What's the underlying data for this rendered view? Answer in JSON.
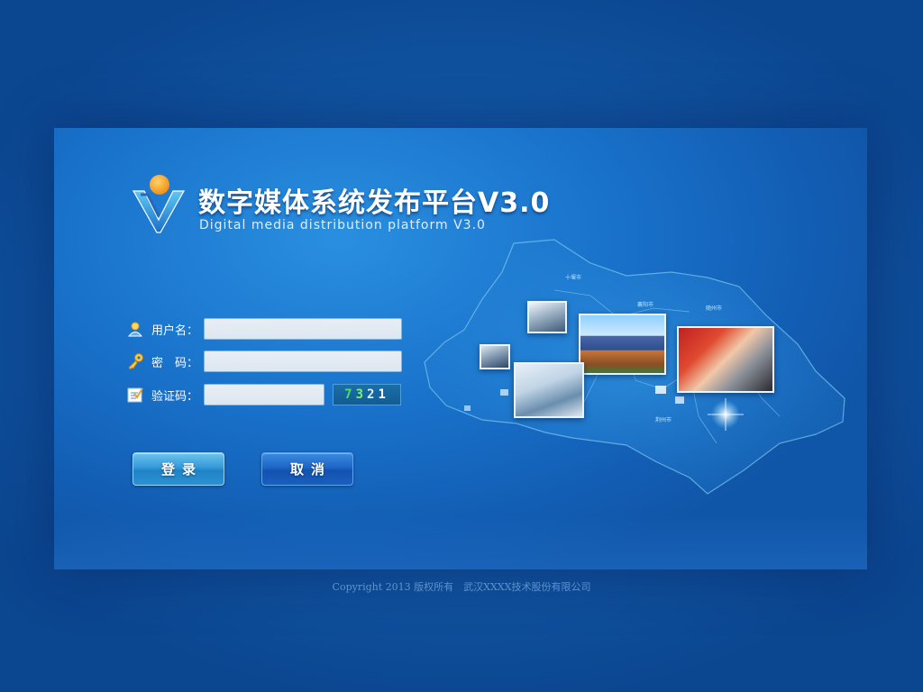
{
  "header": {
    "title_cn": "数字媒体系统发布平台V3.0",
    "title_en": "Digital media distribution platform V3.0"
  },
  "form": {
    "username_label": "用户名：",
    "password_label": "密　码：",
    "captcha_label": "验证码：",
    "username_value": "",
    "password_value": "",
    "captcha_value": "",
    "captcha_code": [
      "7",
      "3",
      "2",
      "1"
    ]
  },
  "buttons": {
    "login_label": "登录",
    "cancel_label": "取消"
  },
  "map_labels": {
    "place_1": "十堰市",
    "place_2": "襄阳市",
    "place_3": "随州市",
    "place_4": "荆州市"
  },
  "footer": {
    "copyright": "Copyright 2013 版权所有　武汉XXXX技术股份有限公司"
  },
  "colors": {
    "background": "#135aa8",
    "panel": "#1a74cc",
    "login_button": "#3599d8",
    "cancel_button": "#1e66c6",
    "captcha_green": "#48e060"
  },
  "icons": {
    "user": "user-icon",
    "password": "key-icon",
    "captcha": "checklist-icon",
    "logo": "logo-icon"
  }
}
